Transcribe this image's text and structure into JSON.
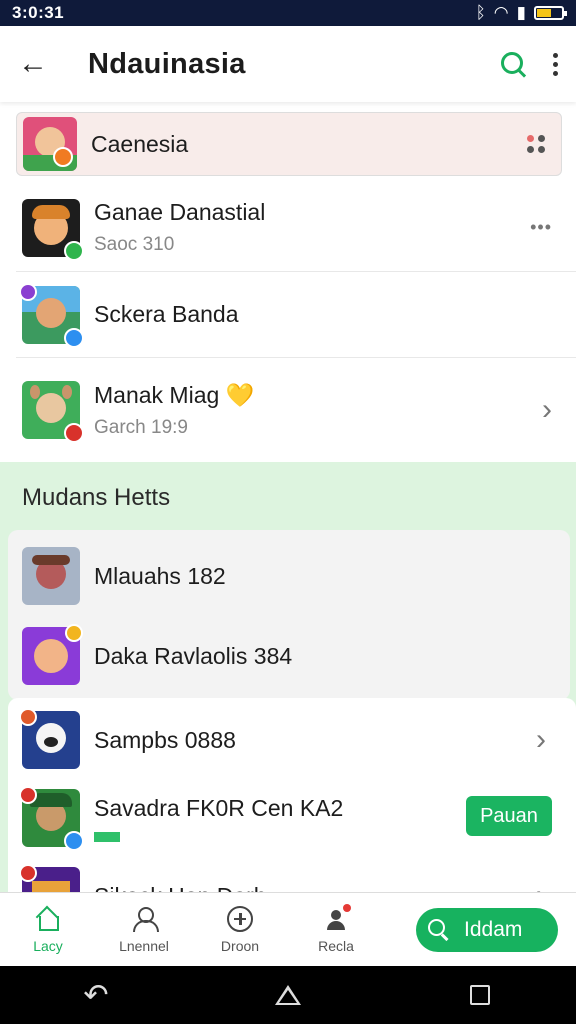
{
  "status_bar": {
    "time": "3:0:31",
    "icons": [
      "bluetooth-icon",
      "wifi-icon",
      "signal-icon",
      "battery-icon"
    ]
  },
  "app_bar": {
    "back_icon": "arrow-left-icon",
    "title": "Ndauinasia",
    "search_icon": "search-icon",
    "menu_icon": "more-vert-icon"
  },
  "list": {
    "items": [
      {
        "name": "Caenesia",
        "subtitle": "",
        "trailing": "grid-dots-icon"
      },
      {
        "name": "Ganae Danastial",
        "subtitle": "Saoc 310",
        "trailing": "more-horiz-icon"
      },
      {
        "name": "Sckera Banda",
        "subtitle": "",
        "trailing": ""
      },
      {
        "name": "Manak Miag",
        "emoji": "💛",
        "subtitle": "Garch 19:9",
        "trailing": "chevron-right-icon"
      }
    ]
  },
  "section": {
    "title": "Mudans Hetts",
    "items": [
      {
        "name": "Mlauahs 182"
      },
      {
        "name": "Daka Ravlaolis 384"
      },
      {
        "name": "Sampbs 0888",
        "trailing": "chevron-right-icon"
      },
      {
        "name": "Savadra FK0R Cen KA2",
        "button": "Pauan"
      },
      {
        "name": "Sikack Han Darh",
        "trailing": "chevron-right-icon"
      }
    ]
  },
  "bottom_nav": {
    "items": [
      {
        "label": "Lacy",
        "icon": "home-icon",
        "active": true
      },
      {
        "label": "Lnennel",
        "icon": "user-icon",
        "active": false
      },
      {
        "label": "Droon",
        "icon": "plus-circle-icon",
        "active": false
      },
      {
        "label": "Recla",
        "icon": "person-icon",
        "active": false
      }
    ],
    "cta": {
      "label": "Iddam",
      "icon": "search-icon"
    }
  },
  "colors": {
    "accent": "#1aaf5d",
    "status_bar": "#0f1a3a",
    "section_bg": "#ddf4df",
    "highlight_row": "#f8ecea"
  }
}
